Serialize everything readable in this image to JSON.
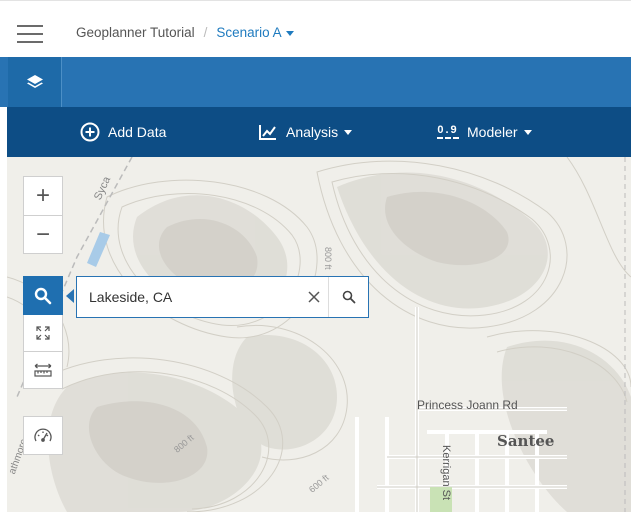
{
  "header": {
    "project": "Geoplanner Tutorial",
    "separator": "/",
    "scenario": "Scenario A"
  },
  "toolbar": {
    "add_data": "Add Data",
    "analysis": "Analysis",
    "modeler": "Modeler",
    "modeler_icon_digits": "0.9"
  },
  "map_controls": {
    "zoom_in": "+",
    "zoom_out": "−"
  },
  "search": {
    "value": "Lakeside, CA",
    "clear": "✕"
  },
  "map_labels": {
    "princess_joann": "Princess Joann Rd",
    "santee": "Santee",
    "kerrigan": "Kerrigan St",
    "sycamore": "Syca",
    "contour_800_a": "800 ft",
    "contour_800_b": "800 ft",
    "contour_600": "600 ft",
    "strathmore": "athmore"
  },
  "colors": {
    "primary_blue": "#2873b3",
    "toolbar_blue": "#0d4d85",
    "link_blue": "#1f7bbf"
  }
}
